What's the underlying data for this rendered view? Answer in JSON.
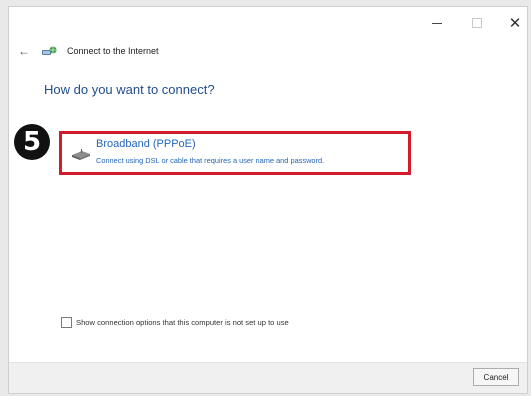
{
  "window": {
    "controls": {
      "minimize_icon": "minimize-icon",
      "maximize_icon": "maximize-icon",
      "close_icon": "close-icon",
      "close_glyph": "✕"
    }
  },
  "nav": {
    "back_glyph": "←",
    "title": "Connect to the Internet"
  },
  "heading": "How do you want to connect?",
  "annotation": {
    "step_number": "5",
    "highlight_color": "#d21c2c"
  },
  "option": {
    "title": "Broadband (PPPoE)",
    "description": "Connect using DSL or cable that requires a user name and password.",
    "icon": "broadband-modem-icon"
  },
  "checkbox": {
    "label": "Show connection options that this computer is not set up to use",
    "checked": false
  },
  "footer": {
    "cancel_label": "Cancel"
  },
  "colors": {
    "link_blue": "#2466b8",
    "heading_blue": "#1f4e8c"
  }
}
